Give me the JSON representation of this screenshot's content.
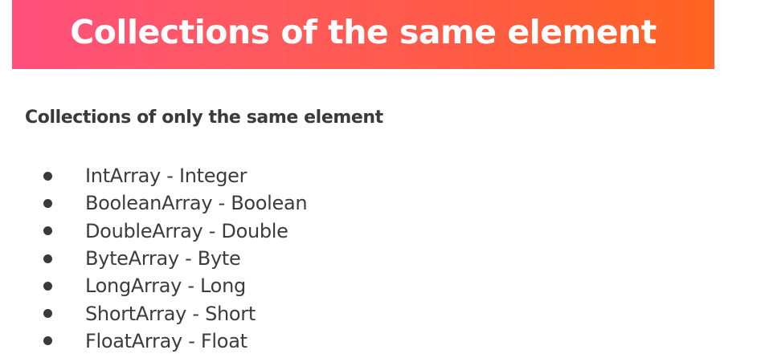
{
  "slide": {
    "title": "Collections of the same element",
    "subheading": "Collections of only the same element",
    "items": [
      "IntArray - Integer",
      "BooleanArray - Boolean",
      "DoubleArray - Double",
      "ByteArray - Byte",
      "LongArray - Long",
      "ShortArray - Short",
      "FloatArray - Float"
    ]
  },
  "colors": {
    "banner_start": "#ff4f7d",
    "banner_end": "#ff6420",
    "title_text": "#ffffff",
    "body_text": "#3a3a3a"
  }
}
